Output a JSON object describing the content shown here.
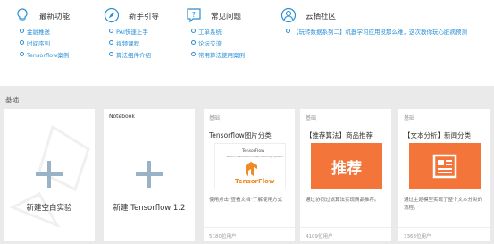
{
  "features": {
    "title": "最新功能",
    "links": [
      "金融推送",
      "时间序列",
      "Tensorflow案例"
    ]
  },
  "guide": {
    "title": "新手引导",
    "links": [
      "PAI快速上手",
      "视频课程",
      "算法组件介绍"
    ]
  },
  "faq": {
    "title": "常见问题",
    "links": [
      "工单系统",
      "论坛交流",
      "常用算法使用案例"
    ]
  },
  "community": {
    "title": "云栖社区",
    "links": [
      "【玩转数据系列二】机器学习应用没那么难，这次教你玩心脏病预测"
    ]
  },
  "section_label": "基础",
  "cards": [
    {
      "label": "新建空白实验"
    },
    {
      "tag": "Notebook",
      "label": "新建 Tensorflow 1.2"
    },
    {
      "tag": "基础",
      "title": "Tensorflow图片分类",
      "desc": "使用点击\"查看文档\"了解使用方式",
      "users": "5180位用户",
      "img_title": "TensorFlow",
      "img_sub": "Second Generation Deep Learning System",
      "img_logo": "TensorFlow"
    },
    {
      "tag": "基础",
      "title": "【推荐算法】商品推荐",
      "desc": "通过协同过滤算法实现商品推荐。",
      "users": "4109位用户",
      "img_text": "推荐"
    },
    {
      "tag": "基础",
      "title": "【文本分析】新闻分类",
      "desc": "通过主题模型实现了整个文本分类的流程。",
      "users": "3363位用户"
    }
  ]
}
